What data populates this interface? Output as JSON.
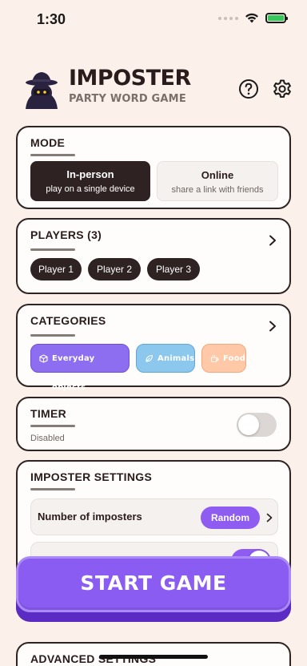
{
  "status_bar": {
    "time": "1:30"
  },
  "header": {
    "title": "IMPOSTER",
    "subtitle": "PARTY WORD GAME",
    "help_icon": "question-circle-icon",
    "settings_icon": "gear-icon"
  },
  "mode": {
    "title": "MODE",
    "options": [
      {
        "label": "In-person",
        "sublabel": "play on a single device",
        "selected": true
      },
      {
        "label": "Online",
        "sublabel": "share a link with friends",
        "selected": false
      }
    ]
  },
  "players": {
    "title": "PLAYERS (3)",
    "list": [
      "Player 1",
      "Player 2",
      "Player 3"
    ]
  },
  "categories": {
    "title": "CATEGORIES",
    "items": [
      {
        "label": "Everyday objects",
        "icon": "cube-icon",
        "color": "#8e6ef0"
      },
      {
        "label": "Animals",
        "icon": "leaf-icon",
        "color": "#8cc8ee"
      },
      {
        "label": "Food",
        "icon": "cup-icon",
        "color": "#ffc9a8"
      }
    ]
  },
  "timer": {
    "title": "TIMER",
    "status": "Disabled",
    "enabled": false
  },
  "imposter_settings": {
    "title": "IMPOSTER SETTINGS",
    "number_label": "Number of imposters",
    "number_value": "Random",
    "second_toggle_on": true
  },
  "start_button": {
    "label": "START GAME"
  },
  "advanced": {
    "title": "ADVANCED SETTINGS"
  },
  "colors": {
    "background": "#fbf1ea",
    "accent": "#8e5cf0",
    "dark": "#2f2222"
  }
}
